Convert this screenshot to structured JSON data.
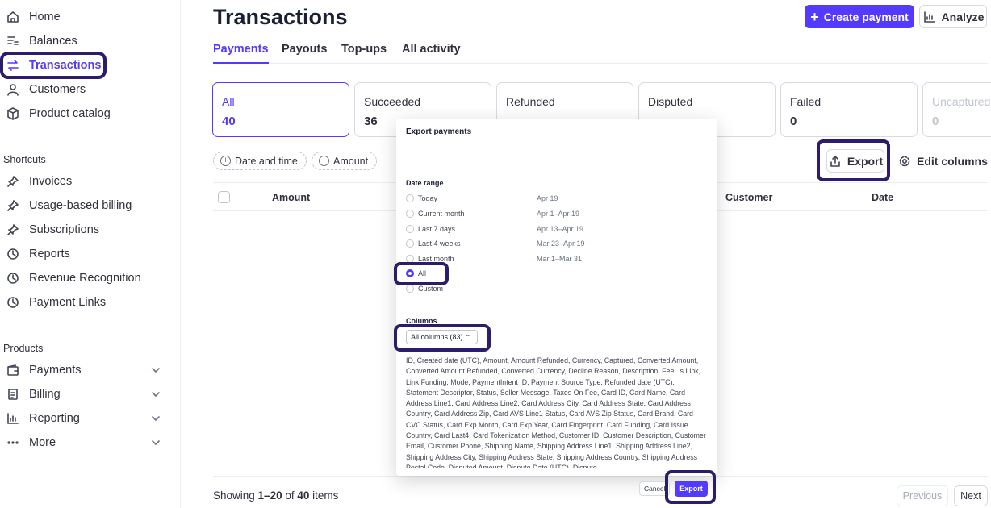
{
  "sidebar": {
    "items": [
      {
        "label": "Home",
        "icon": "home-icon"
      },
      {
        "label": "Balances",
        "icon": "balances-icon"
      },
      {
        "label": "Transactions",
        "icon": "transactions-icon"
      },
      {
        "label": "Customers",
        "icon": "customers-icon"
      },
      {
        "label": "Product catalog",
        "icon": "product-catalog-icon"
      }
    ],
    "shortcuts_heading": "Shortcuts",
    "shortcuts": [
      {
        "label": "Invoices",
        "icon": "pin-icon"
      },
      {
        "label": "Usage-based billing",
        "icon": "pin-icon"
      },
      {
        "label": "Subscriptions",
        "icon": "pin-icon"
      },
      {
        "label": "Reports",
        "icon": "clock-icon"
      },
      {
        "label": "Revenue Recognition",
        "icon": "clock-icon"
      },
      {
        "label": "Payment Links",
        "icon": "clock-icon"
      }
    ],
    "products_heading": "Products",
    "products": [
      {
        "label": "Payments",
        "icon": "wallet-icon"
      },
      {
        "label": "Billing",
        "icon": "billing-icon"
      },
      {
        "label": "Reporting",
        "icon": "bar-chart-icon"
      },
      {
        "label": "More",
        "icon": "more-icon"
      }
    ]
  },
  "header": {
    "title": "Transactions",
    "create_label": "Create payment",
    "analyze_label": "Analyze"
  },
  "tabs": [
    "Payments",
    "Payouts",
    "Top-ups",
    "All activity"
  ],
  "cards": [
    {
      "label": "All",
      "value": "40"
    },
    {
      "label": "Succeeded",
      "value": "36"
    },
    {
      "label": "Refunded",
      "value": ""
    },
    {
      "label": "Disputed",
      "value": ""
    },
    {
      "label": "Failed",
      "value": "0"
    },
    {
      "label": "Uncaptured",
      "value": "0"
    }
  ],
  "filters": [
    "Date and time",
    "Amount"
  ],
  "toolbar": {
    "export_label": "Export",
    "edit_columns_label": "Edit columns"
  },
  "table": {
    "headers": [
      "Amount",
      "Customer",
      "Date"
    ]
  },
  "footer": {
    "showing_prefix": "Showing ",
    "range": "1–20",
    "of": " of ",
    "total": "40",
    "suffix": " items",
    "previous_label": "Previous",
    "next_label": "Next"
  },
  "dialog": {
    "title": "Export payments",
    "date_range_label": "Date range",
    "options": [
      {
        "label": "Today",
        "value": "Apr 19"
      },
      {
        "label": "Current month",
        "value": "Apr 1–Apr 19"
      },
      {
        "label": "Last 7 days",
        "value": "Apr 13–Apr 19"
      },
      {
        "label": "Last 4 weeks",
        "value": "Mar 23–Apr 19"
      },
      {
        "label": "Last month",
        "value": "Mar 1–Mar 31"
      },
      {
        "label": "All",
        "value": ""
      },
      {
        "label": "Custom",
        "value": ""
      }
    ],
    "selected_option": "All",
    "columns_label": "Columns",
    "columns_select": "All columns (83)",
    "columns_list": "ID, Created date (UTC), Amount, Amount Refunded, Currency, Captured, Converted Amount, Converted Amount Refunded, Converted Currency, Decline Reason, Description, Fee, Is Link, Link Funding, Mode, PaymentIntent ID, Payment Source Type, Refunded date (UTC), Statement Descriptor, Status, Seller Message, Taxes On Fee, Card ID, Card Name, Card Address Line1, Card Address Line2, Card Address City, Card Address State, Card Address Country, Card Address Zip, Card AVS Line1 Status, Card AVS Zip Status, Card Brand, Card CVC Status, Card Exp Month, Card Exp Year, Card Fingerprint, Card Funding, Card Issue Country, Card Last4, Card Tokenization Method, Customer ID, Customer Description, Customer Email, Customer Phone, Shipping Name, Shipping Address Line1, Shipping Address Line2, Shipping Address City, Shipping Address State, Shipping Address Country, Shipping Address Postal Code, Disputed Amount, Dispute Date (UTC), Dispute",
    "cancel_label": "Cancel",
    "export_label": "Export"
  },
  "colors": {
    "accent": "#533afd",
    "highlight": "#2d1b6b",
    "text": "#30313d"
  }
}
